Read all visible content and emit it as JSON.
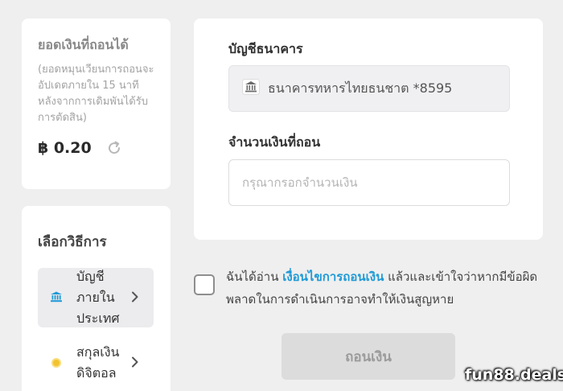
{
  "balance": {
    "title": "ยอดเงินที่ถอนได้",
    "note": "(ยอดหมุนเวียนการถอนจะอัปเดตภายใน 15 นาที หลังจากการเดิมพันได้รับการตัดสิน)",
    "amount": "฿ 0.20",
    "refresh_icon": "refresh-icon"
  },
  "methods": {
    "title": "เลือกวิธีการ",
    "items": [
      {
        "label": "บัญชีภายในประเทศ",
        "icon": "bank-icon",
        "active": true
      },
      {
        "label": "สกุลเงินดิจิตอล",
        "icon": "coin-icon",
        "active": false
      }
    ]
  },
  "form": {
    "bank_label": "บัญชีธนาคาร",
    "bank_value": "ธนาคารทหารไทยธนชาต *8595",
    "amount_label": "จำนวนเงินที่ถอน",
    "amount_placeholder": "กรุณากรอกจำนวนเงิน",
    "amount_value": ""
  },
  "terms": {
    "prefix": "ฉันได้อ่าน ",
    "link": "เงื่อนไขการถอนเงิน",
    "suffix": " แล้วและเข้าใจว่าหากมีข้อผิดพลาดในการดำเนินการอาจทำให้เงินสูญหาย",
    "checked": false
  },
  "submit_label": "ถอนเงิน",
  "watermark": "fun88.deals",
  "colors": {
    "link": "#1f9ad6",
    "bank_icon": "#1f9ad6",
    "coin": "#f2c230",
    "disabled_button": "#dcdcdc"
  }
}
